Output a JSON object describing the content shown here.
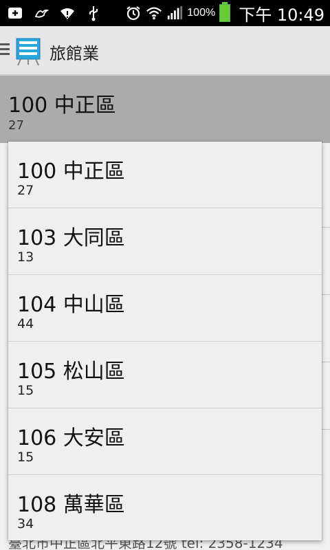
{
  "status_bar": {
    "battery_percent": "100%",
    "time": "下午 10:49",
    "icons": [
      "add-icon",
      "bird-icon",
      "wifi-alert-icon",
      "usb-icon",
      "alarm-icon",
      "wifi-icon",
      "signal-icon",
      "battery-icon"
    ]
  },
  "action_bar": {
    "title": "旅館業",
    "app_icon": "presentation-board-icon"
  },
  "spinner": {
    "selected_name": "100 中正區",
    "selected_count": "27"
  },
  "dropdown": {
    "items": [
      {
        "name": "100 中正區",
        "count": "27"
      },
      {
        "name": "103 大同區",
        "count": "13"
      },
      {
        "name": "104 中山區",
        "count": "44"
      },
      {
        "name": "105 松山區",
        "count": "15"
      },
      {
        "name": "106 大安區",
        "count": "15"
      },
      {
        "name": "108 萬華區",
        "count": "34"
      }
    ]
  },
  "background_list": {
    "footer_text": "臺北市中正區北平東路12號  tel: 2358-1234"
  },
  "colors": {
    "status_bar_bg": "#000000",
    "action_bar_bg": "#e6e6e6",
    "spinner_bg": "#ababab",
    "dropdown_bg": "#efefef",
    "battery": "#66cc33"
  }
}
